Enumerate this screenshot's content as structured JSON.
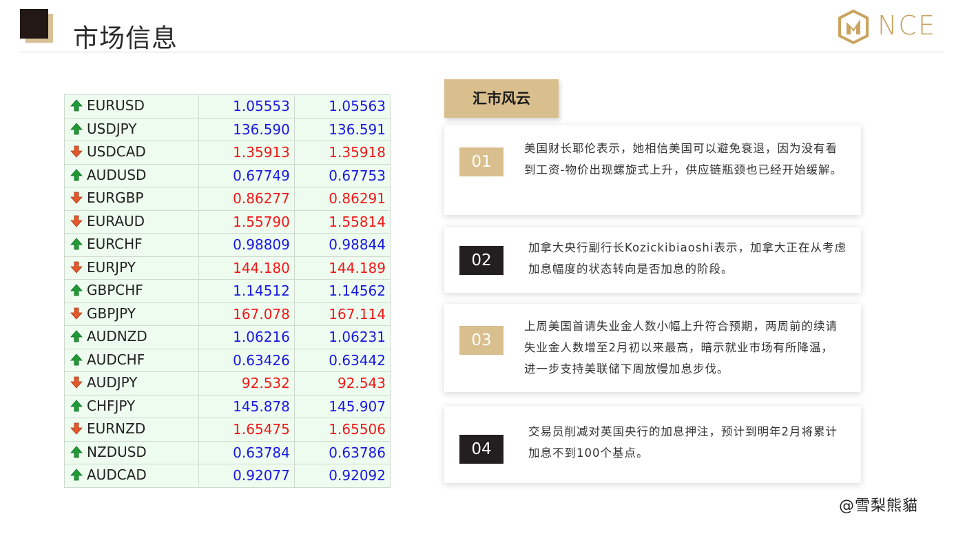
{
  "header": {
    "title": "市场信息",
    "logo_text": "NCE"
  },
  "colors": {
    "gold": "#d9bf8e",
    "dark": "#231f20",
    "up": "#1818e0",
    "down": "#f01818"
  },
  "fx_rows": [
    {
      "symbol": "EURUSD",
      "bid": "1.05553",
      "ask": "1.05563",
      "dir": "up"
    },
    {
      "symbol": "USDJPY",
      "bid": "136.590",
      "ask": "136.591",
      "dir": "up"
    },
    {
      "symbol": "USDCAD",
      "bid": "1.35913",
      "ask": "1.35918",
      "dir": "down"
    },
    {
      "symbol": "AUDUSD",
      "bid": "0.67749",
      "ask": "0.67753",
      "dir": "up"
    },
    {
      "symbol": "EURGBP",
      "bid": "0.86277",
      "ask": "0.86291",
      "dir": "down"
    },
    {
      "symbol": "EURAUD",
      "bid": "1.55790",
      "ask": "1.55814",
      "dir": "down"
    },
    {
      "symbol": "EURCHF",
      "bid": "0.98809",
      "ask": "0.98844",
      "dir": "up"
    },
    {
      "symbol": "EURJPY",
      "bid": "144.180",
      "ask": "144.189",
      "dir": "down"
    },
    {
      "symbol": "GBPCHF",
      "bid": "1.14512",
      "ask": "1.14562",
      "dir": "up"
    },
    {
      "symbol": "GBPJPY",
      "bid": "167.078",
      "ask": "167.114",
      "dir": "down"
    },
    {
      "symbol": "AUDNZD",
      "bid": "1.06216",
      "ask": "1.06231",
      "dir": "up"
    },
    {
      "symbol": "AUDCHF",
      "bid": "0.63426",
      "ask": "0.63442",
      "dir": "up"
    },
    {
      "symbol": "AUDJPY",
      "bid": "92.532",
      "ask": "92.543",
      "dir": "down"
    },
    {
      "symbol": "CHFJPY",
      "bid": "145.878",
      "ask": "145.907",
      "dir": "up"
    },
    {
      "symbol": "EURNZD",
      "bid": "1.65475",
      "ask": "1.65506",
      "dir": "down"
    },
    {
      "symbol": "NZDUSD",
      "bid": "0.63784",
      "ask": "0.63786",
      "dir": "up"
    },
    {
      "symbol": "AUDCAD",
      "bid": "0.92077",
      "ask": "0.92092",
      "dir": "up"
    }
  ],
  "section": {
    "tag": "汇市风云"
  },
  "cards": [
    {
      "num": "01",
      "text": "美国财长耶伦表示，她相信美国可以避免衰退，因为没有看到工资-物价出现螺旋式上升，供应链瓶颈也已经开始缓解。"
    },
    {
      "num": "02",
      "text": "加拿大央行副行长Kozickibiaoshi表示，加拿大正在从考虑加息幅度的状态转向是否加息的阶段。"
    },
    {
      "num": "03",
      "text": "上周美国首请失业金人数小幅上升符合预期，两周前的续请失业金人数增至2月初以来最高，暗示就业市场有所降温，进一步支持美联储下周放慢加息步伐。"
    },
    {
      "num": "04",
      "text": "交易员削减对英国央行的加息押注，预计到明年2月将累计加息不到100个基点。"
    }
  ],
  "watermark": "@雪梨熊貓"
}
